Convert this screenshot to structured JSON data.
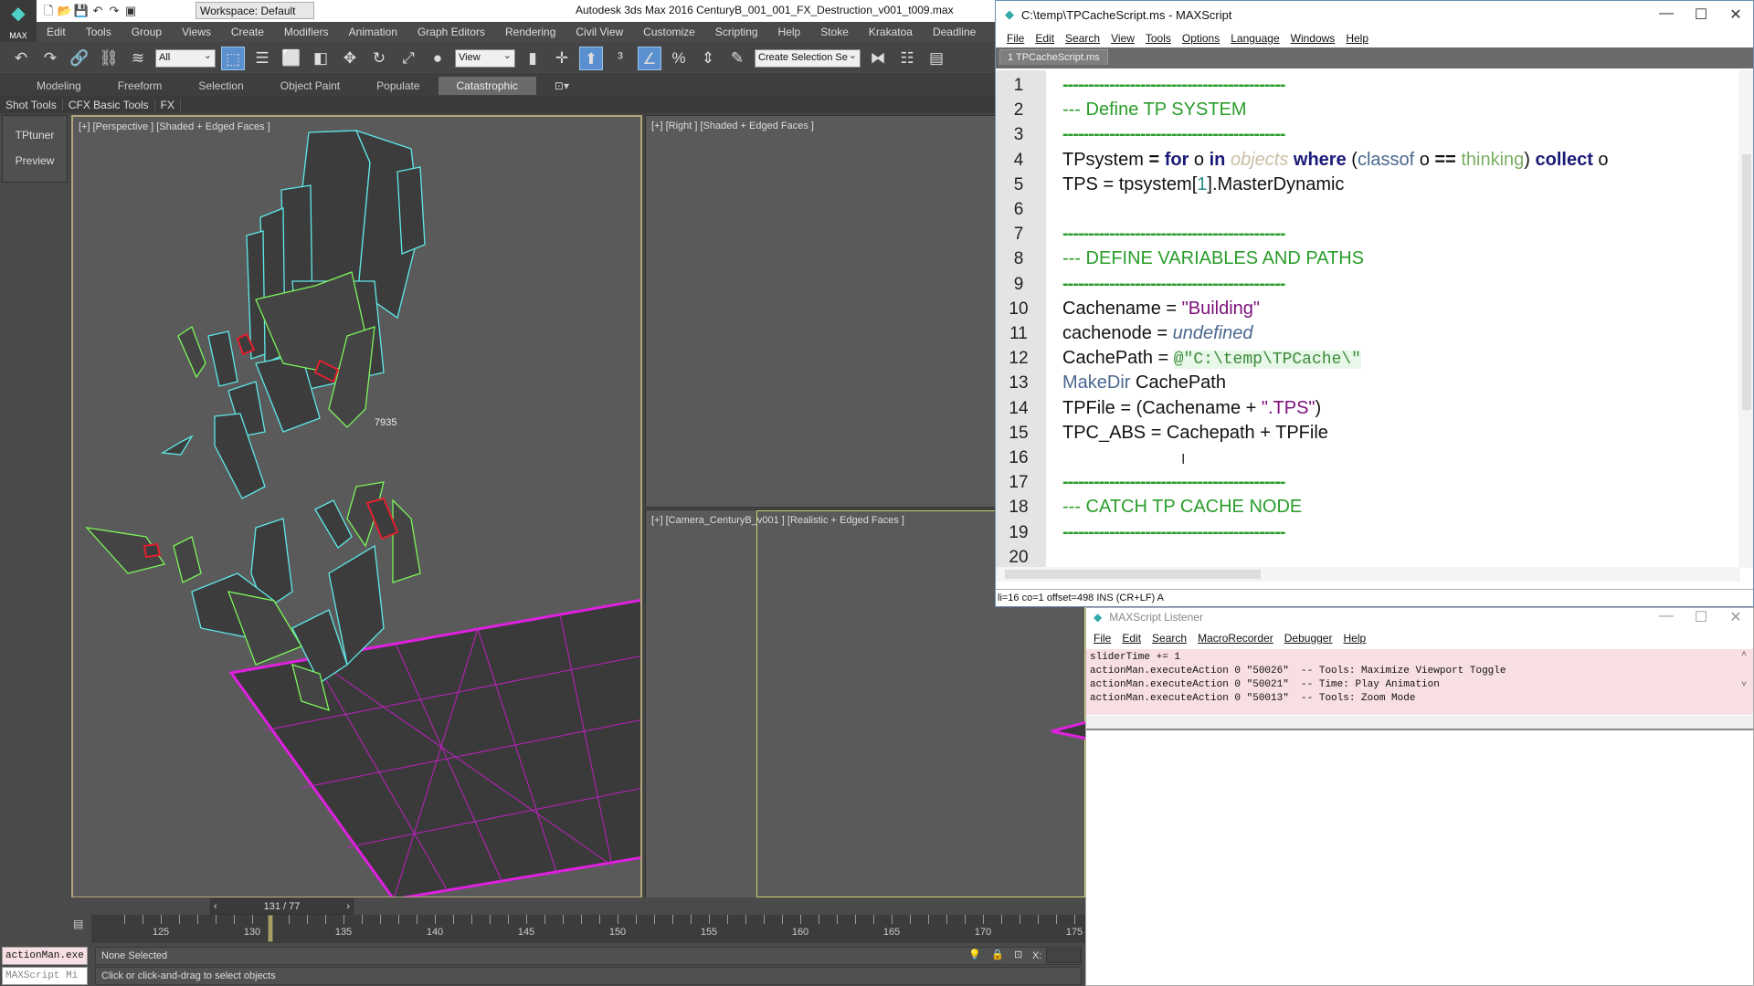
{
  "app": {
    "logo_label": "MAX",
    "workspace": "Workspace: Default",
    "title": "Autodesk 3ds Max 2016    CenturyB_001_001_FX_Destruction_v001_t009.max",
    "menu": [
      "Edit",
      "Tools",
      "Group",
      "Views",
      "Create",
      "Modifiers",
      "Animation",
      "Graph Editors",
      "Rendering",
      "Civil View",
      "Customize",
      "Scripting",
      "Help",
      "Stoke",
      "Krakatoa",
      "Deadline"
    ],
    "toolbar": {
      "selection_filter": "All",
      "ref_coord": "View",
      "named_selection": "Create Selection Se"
    },
    "ribbon_tabs": [
      "Modeling",
      "Freeform",
      "Selection",
      "Object Paint",
      "Populate",
      "Catastrophic"
    ],
    "ribbon_active": "Catastrophic",
    "sub_tabs": [
      "Shot Tools",
      "CFX Basic Tools",
      "FX"
    ],
    "left_panel": [
      "TPtuner",
      "Preview"
    ]
  },
  "viewports": {
    "perspective": "[+] [Perspective ] [Shaded + Edged Faces ]",
    "right": "[+] [Right ] [Shaded + Edged Faces ]",
    "camera": "[+] [Camera_CenturyB_v001 ] [Realistic + Edged Faces ]",
    "object_label": "7935"
  },
  "timeline": {
    "frame_display": "131 / 77",
    "current_frame": 131,
    "ticks": [
      125,
      130,
      135,
      140,
      145,
      150,
      155,
      160,
      165,
      170,
      175
    ]
  },
  "statusbar": {
    "mini_listener_top": "actionMan.exe",
    "mini_listener_bottom": "MAXScript Mi",
    "selection": "None Selected",
    "prompt": "Click or click-and-drag to select objects",
    "x_label": "X:"
  },
  "editor": {
    "title": "C:\\temp\\TPCacheScript.ms - MAXScript",
    "menu": [
      "File",
      "Edit",
      "Search",
      "View",
      "Tools",
      "Options",
      "Language",
      "Windows",
      "Help"
    ],
    "tab": "1 TPCacheScript.ms",
    "lines": [
      [
        [
          "-------------------------------------------",
          "dash"
        ]
      ],
      [
        [
          "--- Define TP SYSTEM",
          "cmt"
        ]
      ],
      [
        [
          "-------------------------------------------",
          "dash"
        ]
      ],
      [
        [
          "TPsystem ",
          ""
        ],
        [
          "=",
          "op"
        ],
        [
          " ",
          ""
        ],
        [
          "for",
          "kw"
        ],
        [
          " o ",
          ""
        ],
        [
          "in",
          "kw"
        ],
        [
          " ",
          ""
        ],
        [
          "objects",
          "obj"
        ],
        [
          " ",
          ""
        ],
        [
          "where",
          "kw"
        ],
        [
          " (",
          ""
        ],
        [
          "classof",
          "fn"
        ],
        [
          " o ",
          ""
        ],
        [
          "==",
          "op"
        ],
        [
          " ",
          ""
        ],
        [
          "thinking",
          "ident"
        ],
        [
          ") ",
          ""
        ],
        [
          "collect",
          "kw"
        ],
        [
          " o",
          ""
        ]
      ],
      [
        [
          "TPS = tpsystem[",
          ""
        ],
        [
          "1",
          "num"
        ],
        [
          "].MasterDynamic",
          ""
        ]
      ],
      [],
      [
        [
          "-------------------------------------------",
          "dash"
        ]
      ],
      [
        [
          "--- DEFINE VARIABLES AND PATHS",
          "cmt"
        ]
      ],
      [
        [
          "-------------------------------------------",
          "dash"
        ]
      ],
      [
        [
          "Cachename = ",
          ""
        ],
        [
          "\"Building\"",
          "str"
        ]
      ],
      [
        [
          "cachenode = ",
          ""
        ],
        [
          "undefined",
          "undef"
        ]
      ],
      [
        [
          "CachePath = ",
          ""
        ],
        [
          "@\"C:\\temp\\TPCache\\\"",
          "vstr"
        ]
      ],
      [
        [
          "MakeDir",
          "fn"
        ],
        [
          " CachePath",
          ""
        ]
      ],
      [
        [
          "TPFile = (Cachename + ",
          ""
        ],
        [
          "\".TPS\"",
          "str"
        ],
        [
          ")",
          ""
        ]
      ],
      [
        [
          "TPC_ABS = Cachepath + TPFile",
          ""
        ]
      ],
      [],
      [
        [
          "-------------------------------------------",
          "dash"
        ]
      ],
      [
        [
          "--- CATCH TP CACHE NODE",
          "cmt"
        ]
      ],
      [
        [
          "-------------------------------------------",
          "dash"
        ]
      ],
      []
    ],
    "status": "li=16 co=1 offset=498 INS (CR+LF) A"
  },
  "listener": {
    "title": "MAXScript Listener",
    "menu": [
      "File",
      "Edit",
      "Search",
      "MacroRecorder",
      "Debugger",
      "Help"
    ],
    "output": [
      "sliderTime += 1",
      "actionMan.executeAction 0 \"50026\"  -- Tools: Maximize Viewport Toggle",
      "actionMan.executeAction 0 \"50021\"  -- Time: Play Animation",
      "actionMan.executeAction 0 \"50013\"  -- Tools: Zoom Mode"
    ],
    "input": ""
  },
  "colors": {
    "cyan_wire": "#5fe8e8",
    "green_wire": "#7cf55a",
    "red_wire": "#e02030",
    "grid": "#e020e0",
    "active_viewport": "#b2a57a"
  }
}
